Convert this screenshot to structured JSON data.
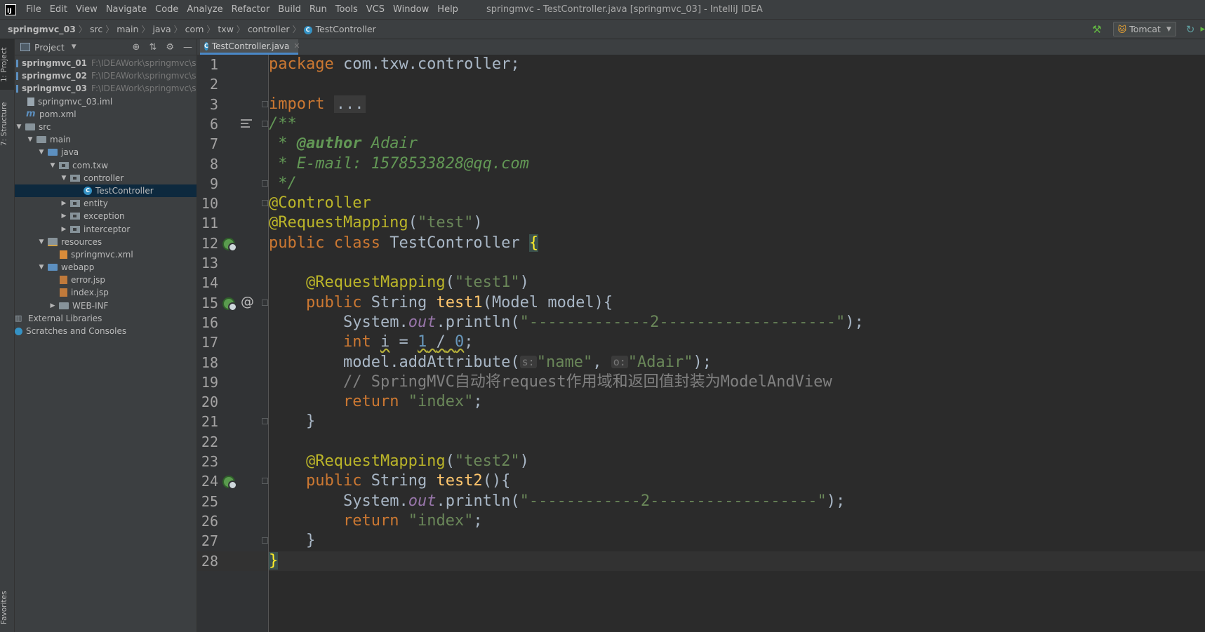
{
  "menubar": {
    "logo": "IJ",
    "items": [
      "File",
      "Edit",
      "View",
      "Navigate",
      "Code",
      "Analyze",
      "Refactor",
      "Build",
      "Run",
      "Tools",
      "VCS",
      "Window",
      "Help"
    ],
    "window_title": "springmvc - TestController.java [springmvc_03] - IntelliJ IDEA"
  },
  "navbar": {
    "crumbs": [
      "springmvc_03",
      "src",
      "main",
      "java",
      "com",
      "txw",
      "controller",
      "TestController"
    ],
    "run_config": "Tomcat"
  },
  "toolstrip": {
    "project_tab": "1: Project",
    "structure_tab": "7: Structure",
    "favorites_tab": "Favorites"
  },
  "project_panel": {
    "title": "Project",
    "tree": [
      {
        "label": "springmvc_01",
        "path": "F:\\IDEAWork\\springmvc\\spring"
      },
      {
        "label": "springmvc_02",
        "path": "F:\\IDEAWork\\springmvc\\spring"
      },
      {
        "label": "springmvc_03",
        "path": "F:\\IDEAWork\\springmvc\\spring"
      },
      {
        "label": "springmvc_03.iml"
      },
      {
        "label": "pom.xml"
      },
      {
        "label": "src"
      },
      {
        "label": "main"
      },
      {
        "label": "java"
      },
      {
        "label": "com.txw"
      },
      {
        "label": "controller"
      },
      {
        "label": "TestController"
      },
      {
        "label": "entity"
      },
      {
        "label": "exception"
      },
      {
        "label": "interceptor"
      },
      {
        "label": "resources"
      },
      {
        "label": "springmvc.xml"
      },
      {
        "label": "webapp"
      },
      {
        "label": "error.jsp"
      },
      {
        "label": "index.jsp"
      },
      {
        "label": "WEB-INF"
      },
      {
        "label": "External Libraries"
      },
      {
        "label": "Scratches and Consoles"
      }
    ]
  },
  "editor": {
    "tab_label": "TestController.java",
    "line_numbers": [
      "1",
      "2",
      "3",
      "6",
      "7",
      "8",
      "9",
      "10",
      "11",
      "12",
      "13",
      "14",
      "15",
      "16",
      "17",
      "18",
      "19",
      "20",
      "21",
      "22",
      "23",
      "24",
      "25",
      "26",
      "27",
      "28"
    ],
    "code": {
      "l1_kw": "package",
      "l1_pkg": "com.txw.controller",
      "l3_kw": "import",
      "l3_fold": "...",
      "l6": "/**",
      "l7_star": " * ",
      "l7_tag": "@author",
      "l7_val": " Adair",
      "l8": " * E-mail: 1578533828@qq.com",
      "l9": " */",
      "l10": "@Controller",
      "l11_ann": "@RequestMapping",
      "l11_str": "\"test\"",
      "l12_kw": "public class",
      "l12_cls": "TestController",
      "l14_ann": "@RequestMapping",
      "l14_str": "\"test1\"",
      "l15_kw1": "public",
      "l15_type": "String",
      "l15_name": "test1",
      "l15_ptype": "Model",
      "l15_param": "model",
      "l16_cls": "System",
      "l16_fld": "out",
      "l16_call": "println",
      "l16_str": "\"-------------2-------------------\"",
      "l17_kw": "int",
      "l17_var": "i",
      "l17_n1": "1",
      "l17_op": "/",
      "l17_n2": "0",
      "l18_obj": "model",
      "l18_call": "addAttribute",
      "l18_hint1": "s:",
      "l18_str1": "\"name\"",
      "l18_hint2": "o:",
      "l18_str2": "\"Adair\"",
      "l19": "// SpringMVC自动将request作用域和返回值封装为ModelAndView",
      "l20_kw": "return",
      "l20_str": "\"index\"",
      "l23_ann": "@RequestMapping",
      "l23_str": "\"test2\"",
      "l24_kw1": "public",
      "l24_type": "String",
      "l24_name": "test2",
      "l25_cls": "System",
      "l25_fld": "out",
      "l25_call": "println",
      "l25_str": "\"------------2------------------\"",
      "l26_kw": "return",
      "l26_str": "\"index\""
    }
  },
  "colors": {
    "keyword": "#cc7832",
    "string": "#6a8759",
    "annotation": "#bbb529",
    "comment": "#808080",
    "selection": "#0d293e"
  }
}
